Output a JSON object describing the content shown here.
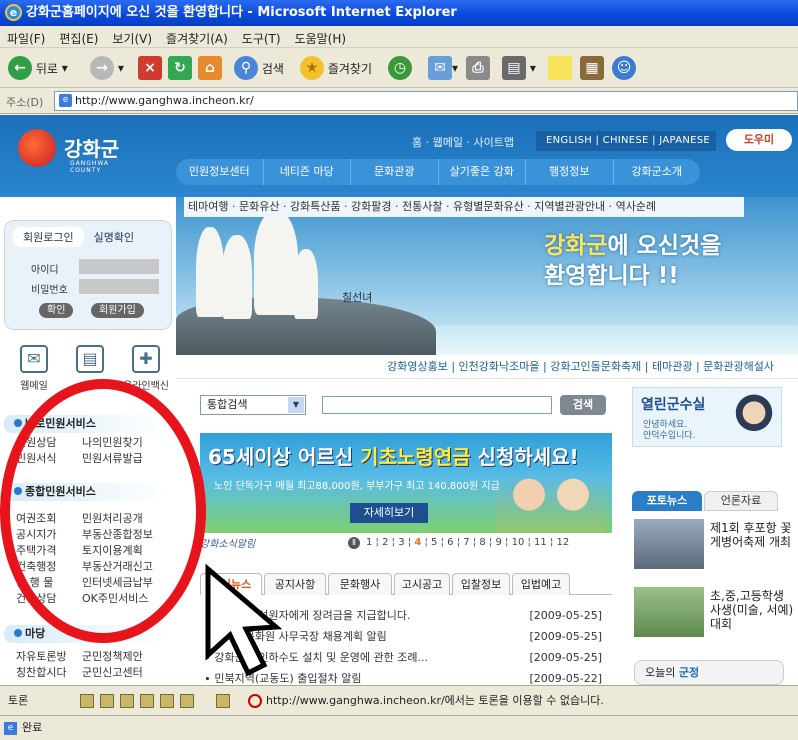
{
  "window": {
    "title": "강화군홈페이지에 오신 것을 환영합니다 - Microsoft Internet Explorer"
  },
  "menu": [
    "파일(F)",
    "편집(E)",
    "보기(V)",
    "즐겨찾기(A)",
    "도구(T)",
    "도움말(H)"
  ],
  "toolbar": {
    "back": "뒤로",
    "search": "검색",
    "favorites": "즐겨찾기"
  },
  "address": {
    "label": "주소(D)",
    "url": "http://www.ganghwa.incheon.kr/"
  },
  "site": {
    "logo_name": "강화군",
    "logo_sub_1": "GANGHWA",
    "logo_sub_2": "COUNTY",
    "toplinks": "홈 · 웹메일 · 사이트맵",
    "langs": "ENGLISH | CHINESE | JAPANESE",
    "help": "도우미",
    "nav": [
      "민원정보센터",
      "네티즌 마당",
      "문화관광",
      "살기좋은 강화",
      "행정정보",
      "강화군소개"
    ],
    "subnav": "테마여행 · 문화유산 · 강화특산품 · 강화팔경 · 전통사찰 · 유형별문화유산 · 지역별관광안내 · 역사순례",
    "hero_caption": "칠선녀",
    "welcome_1": "강화군",
    "welcome_2": "에 오신것을",
    "welcome_3": "환영합니다 !!",
    "quick_links": "강화영상홍보 | 인천강화낙조마을 | 강화고인돌문화축제 | 테마관광 | 문화관광해설사"
  },
  "login": {
    "tab1": "회원로그인",
    "tab2": "실명확인",
    "id_label": "아이디",
    "pw_label": "비밀번호",
    "ok": "확인",
    "join": "회원가입"
  },
  "quick_icons": [
    "웹메일",
    "",
    "온라인백신"
  ],
  "sections": {
    "s1": "바로민원서비스",
    "s1_items": [
      [
        "민원상담",
        "나의민원찾기"
      ],
      [
        "민원서식",
        "민원서류발급"
      ]
    ],
    "s2": "종합민원서비스",
    "s2_items": [
      [
        "여권조회",
        "민원처리공개"
      ],
      [
        "공시지가",
        "부동산종합정보"
      ],
      [
        "주택가격",
        "토지이용계획"
      ],
      [
        "건축행정",
        "부동산거래신고"
      ],
      [
        "간 행 물",
        "인터넷세금납부"
      ],
      [
        "건강상담",
        "OK주민서비스"
      ]
    ],
    "s3": "마당",
    "s3_items": [
      [
        "자유토론방",
        "군민정책제안"
      ],
      [
        "칭찬합시다",
        "군민신고센터"
      ]
    ]
  },
  "search": {
    "select": "통합검색",
    "button": "검색"
  },
  "banner": {
    "head_1": "65세이상 어르신 ",
    "head_2": "기초노령연금",
    "head_3": " 신청하세요!",
    "sub": "노인 단독가구 매월 최고88,000원, 부부가구 최고 140,800원 지급",
    "more": "자세히보기"
  },
  "tagline": "강화소식알림",
  "pager": [
    "1",
    "2",
    "3",
    "4",
    "5",
    "6",
    "7",
    "8",
    "9",
    "10",
    "11",
    "12"
  ],
  "pager_active": "4",
  "tabs": [
    "최신뉴스",
    "공지사항",
    "문화행사",
    "고시공고",
    "입찰정보",
    "입법예고"
  ],
  "news": [
    {
      "t": "∙ 저소득 구성원자에게 장려금을 지급합니다.",
      "d": "[2009-05-25]"
    },
    {
      "t": "∙ 강화군문화원 사무국장 채용계획 알림",
      "d": "[2009-05-25]"
    },
    {
      "t": "∙ 강화군 개인하수도 설치 및 운영에 관한 조례...",
      "d": "[2009-05-25]"
    },
    {
      "t": "∙ 민북지역(교동도) 출입절차 알림",
      "d": "[2009-05-22]"
    }
  ],
  "gunsu": {
    "title": "열린군수실",
    "sub_1": "안녕하세요.",
    "sub_2": "안덕수입니다."
  },
  "photo_tabs": [
    "포토뉴스",
    "언론자료"
  ],
  "photo_news": [
    "제1회 후포항 꽃게병어축제 개최",
    "초,중,고등학생 사생(미술, 서예)대회"
  ],
  "minwon": {
    "pre": "오늘의 ",
    "hl": "군정"
  },
  "linkbar": {
    "label": "토론",
    "message": "http://www.ganghwa.incheon.kr/에서는 토론을 이용할 수 없습니다."
  },
  "status": "완료"
}
